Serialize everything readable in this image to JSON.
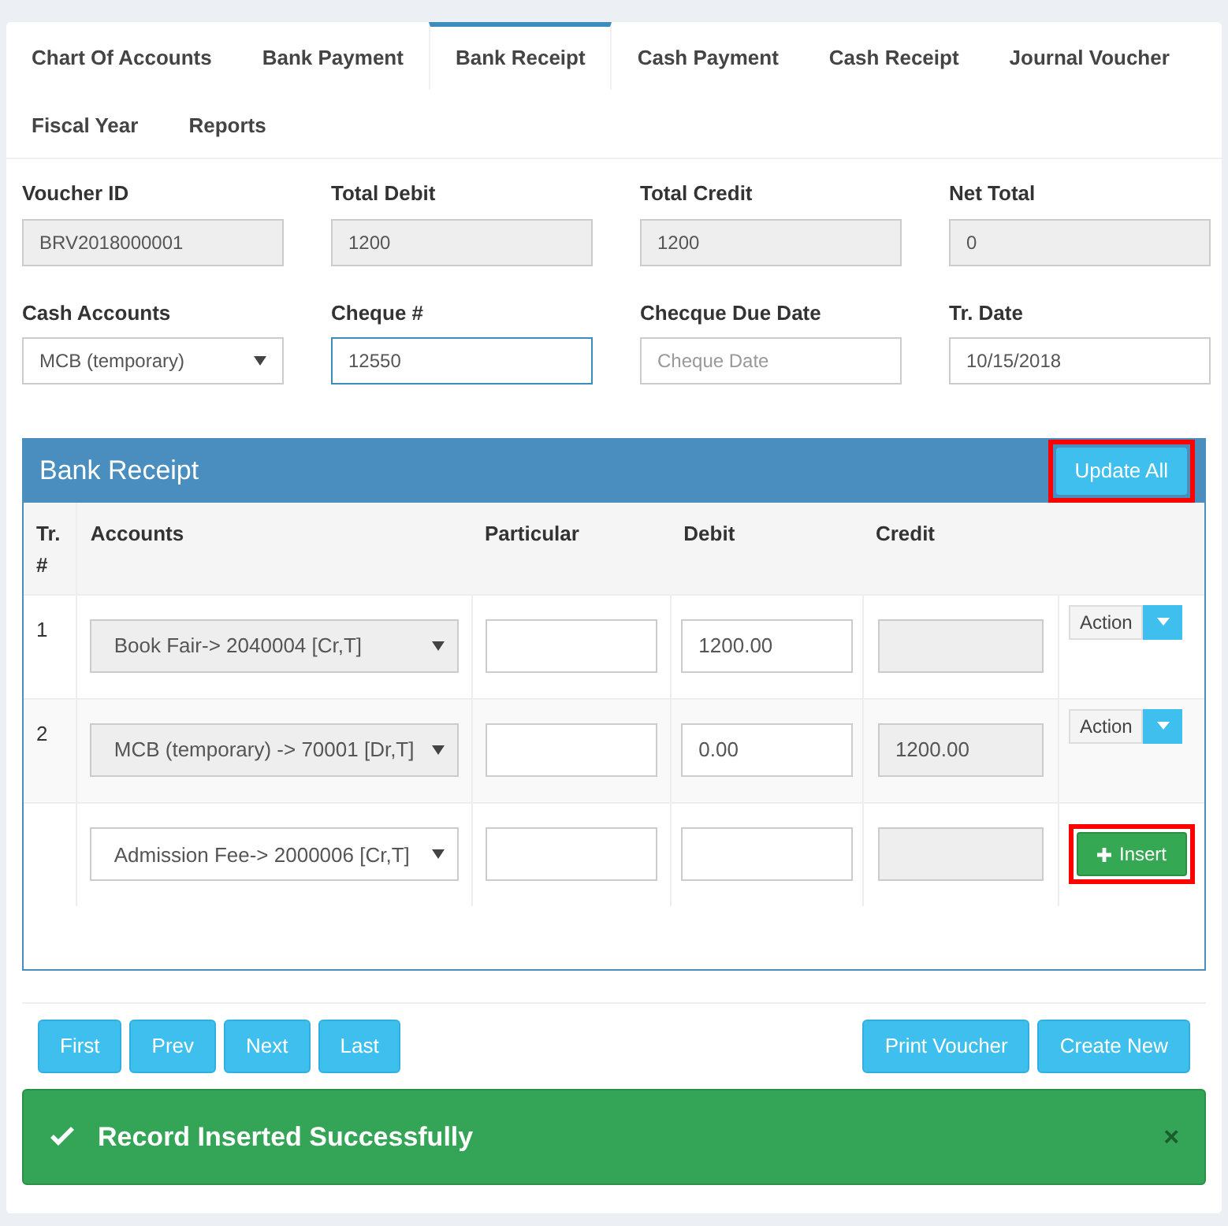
{
  "tabs": [
    {
      "label": "Chart Of Accounts",
      "selected": false
    },
    {
      "label": "Bank Payment",
      "selected": false
    },
    {
      "label": "Bank Receipt",
      "selected": true
    },
    {
      "label": "Cash Payment",
      "selected": false
    },
    {
      "label": "Cash Receipt",
      "selected": false
    },
    {
      "label": "Journal Voucher",
      "selected": false
    },
    {
      "label": "Fiscal Year",
      "selected": false
    },
    {
      "label": "Reports",
      "selected": false
    }
  ],
  "fields": [
    {
      "label": "Voucher ID",
      "kind": "input",
      "value": "BRV2018000001",
      "disabled": true,
      "focused": false
    },
    {
      "label": "Total Debit",
      "kind": "input",
      "value": "1200",
      "disabled": true,
      "focused": false
    },
    {
      "label": "Total Credit",
      "kind": "input",
      "value": "1200",
      "disabled": true,
      "focused": false
    },
    {
      "label": "Net Total",
      "kind": "input",
      "value": "0",
      "disabled": true,
      "focused": false
    },
    {
      "label": "Cash Accounts",
      "kind": "select",
      "value": "MCB (temporary)",
      "disabled": false,
      "focused": false
    },
    {
      "label": "Cheque #",
      "kind": "input",
      "value": "12550",
      "disabled": false,
      "focused": true
    },
    {
      "label": "Checque Due Date",
      "kind": "input",
      "placeholder": "Cheque Date",
      "disabled": false,
      "focused": false
    },
    {
      "label": "Tr. Date",
      "kind": "input",
      "value": "10/15/2018",
      "disabled": false,
      "focused": false
    }
  ],
  "panel": {
    "title": "Bank Receipt",
    "update_button": {
      "label": "Update All",
      "highlighted": true
    }
  },
  "table": {
    "columns": [
      "Tr. #",
      "Accounts",
      "Particular",
      "Debit",
      "Credit"
    ],
    "rows": [
      {
        "number": "1",
        "account": "Book Fair-> 2040004 [Cr,T]",
        "account_disabled": true,
        "debit": "1200.00",
        "credit": "",
        "action": {
          "kind": "dropdown",
          "label": "Action",
          "highlighted": false
        }
      },
      {
        "number": "2",
        "account": "MCB (temporary) -> 70001 [Dr,T]",
        "account_disabled": true,
        "debit": "0.00",
        "credit": "1200.00",
        "action": {
          "kind": "dropdown",
          "label": "Action",
          "highlighted": false
        }
      },
      {
        "account": "Admission Fee-> 2000006 [Cr,T]",
        "account_disabled": false,
        "debit": "",
        "credit": "",
        "action": {
          "kind": "insert",
          "label": "Insert",
          "highlighted": true
        }
      }
    ]
  },
  "nav_buttons": [
    "First",
    "Prev",
    "Next",
    "Last"
  ],
  "action_buttons": [
    "Print Voucher",
    "Create New"
  ],
  "alert": {
    "message": "Record Inserted Successfully",
    "close": "×"
  }
}
